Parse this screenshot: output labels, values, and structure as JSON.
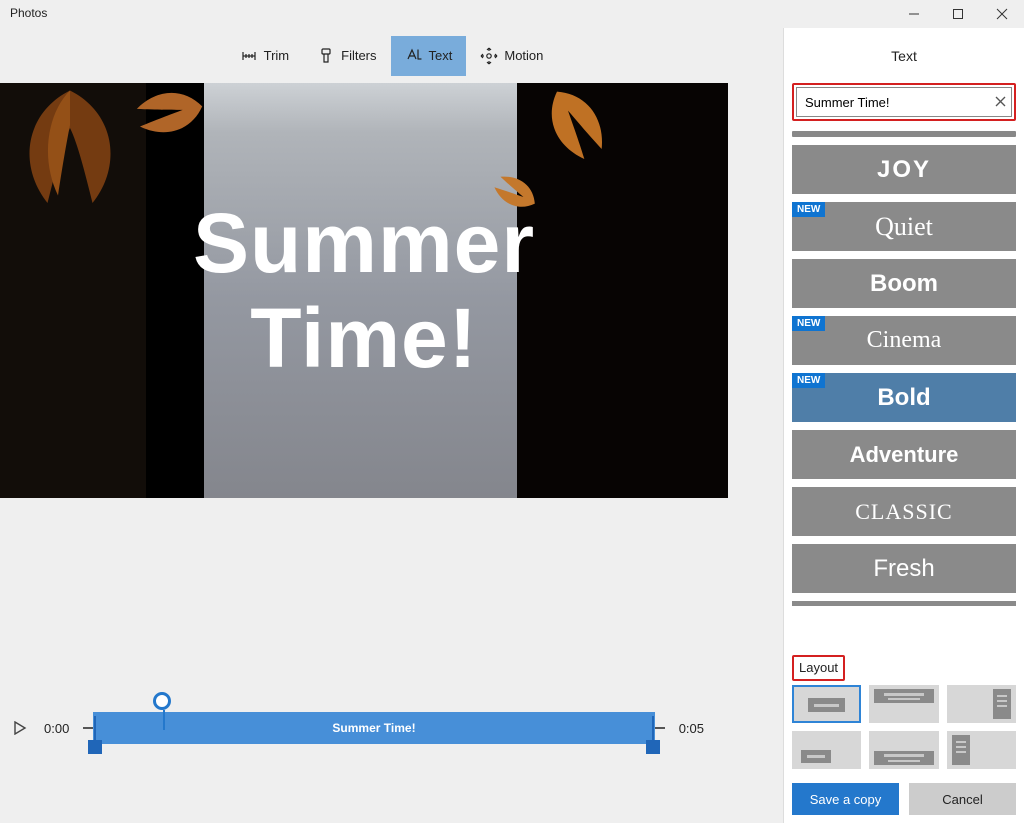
{
  "app_title": "Photos",
  "window_controls": {
    "min": "—",
    "max": "▢",
    "close": "✕"
  },
  "toolbar": {
    "trim": "Trim",
    "filters": "Filters",
    "text": "Text",
    "motion": "Motion"
  },
  "preview": {
    "overlay": "Summer\nTime!"
  },
  "timeline": {
    "start": "0:00",
    "end": "0:05",
    "clip_label": "Summer Time!"
  },
  "panel": {
    "title": "Text",
    "input_value": "Summer Time!",
    "new_badge": "NEW",
    "styles": [
      {
        "label": "JOY",
        "className": "joy",
        "is_new": false,
        "selected": false
      },
      {
        "label": "Quiet",
        "className": "quiet",
        "is_new": true,
        "selected": false
      },
      {
        "label": "Boom",
        "className": "boom",
        "is_new": false,
        "selected": false
      },
      {
        "label": "Cinema",
        "className": "cinema",
        "is_new": true,
        "selected": false
      },
      {
        "label": "Bold",
        "className": "bold",
        "is_new": true,
        "selected": true
      },
      {
        "label": "Adventure",
        "className": "adventure",
        "is_new": false,
        "selected": false
      },
      {
        "label": "CLASSIC",
        "className": "classic",
        "is_new": false,
        "selected": false
      },
      {
        "label": "Fresh",
        "className": "fresh",
        "is_new": false,
        "selected": false
      }
    ],
    "layout_label": "Layout",
    "save": "Save a copy",
    "cancel": "Cancel"
  }
}
